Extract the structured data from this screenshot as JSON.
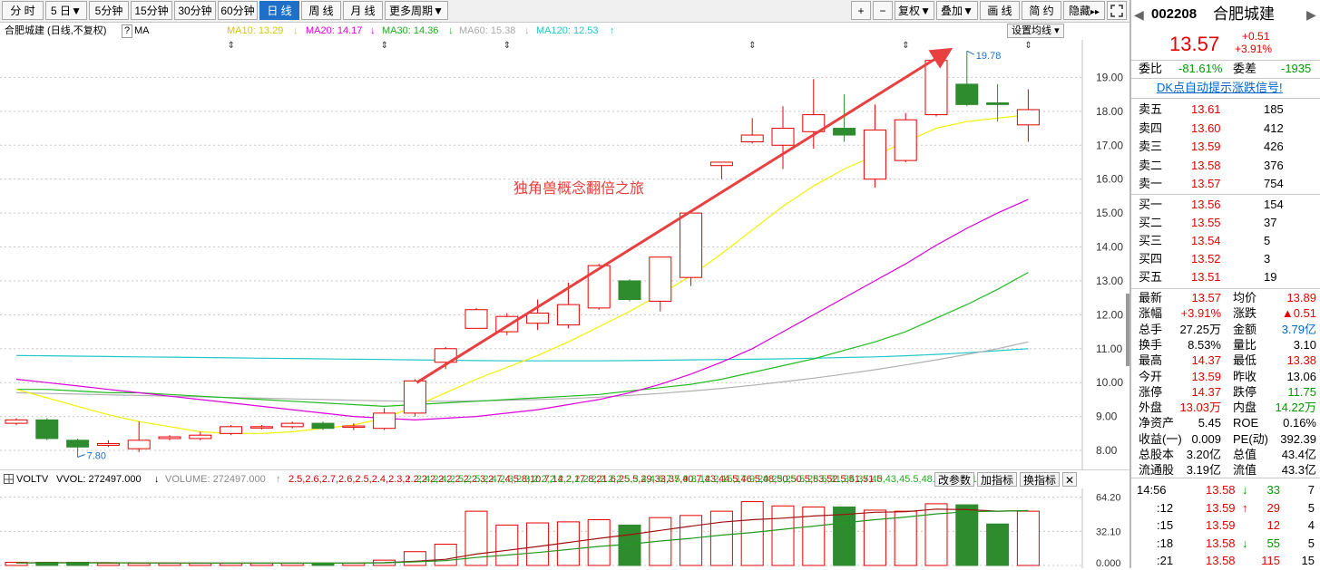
{
  "toolbar": {
    "periods": [
      "分 时",
      "5 日",
      "5分钟",
      "15分钟",
      "30分钟",
      "60分钟",
      "日 线",
      "周 线",
      "月 线",
      "更多周期"
    ],
    "active": "日 线",
    "right": [
      "+",
      "−",
      "复权",
      "叠加",
      "画 线",
      "简 约",
      "隐藏"
    ],
    "dropdown_arrow": "▼",
    "hide_arrows": "▸▸"
  },
  "info": {
    "stock_label": "合肥城建 (日线,不复权)",
    "help": "?",
    "ma": "MA",
    "ma10": "MA10: 13.29",
    "ma20": "MA20: 14.17",
    "ma30": "MA30: 14.36",
    "ma60": "MA60: 15.38",
    "ma120": "MA120: 12.53",
    "arrow_down": "↓",
    "arrow_up": "↑",
    "settings": "设置均线",
    "settings_arrow": "▾"
  },
  "colors": {
    "up": "#e60000",
    "down": "#2e8b2e",
    "ma10": "#f2f200",
    "ma20": "#dd00dd",
    "ma30": "#22bb22",
    "ma60": "#b0b0b0",
    "ma120": "#22c8c8",
    "accent": "#1e6fc8"
  },
  "chart_data": {
    "type": "candlestick",
    "annotation": "独角兽概念翻倍之旅",
    "max_label": "19.78",
    "min_label": "7.80",
    "y_ticks": [
      "19.00",
      "18.00",
      "17.00",
      "16.00",
      "15.00",
      "14.00",
      "13.00",
      "12.00",
      "11.00",
      "10.00",
      "9.00",
      "8.00"
    ],
    "ylim": [
      7.6,
      20.0
    ],
    "candles": [
      {
        "o": 8.8,
        "c": 8.9,
        "h": 8.95,
        "l": 8.75
      },
      {
        "o": 8.9,
        "c": 8.35,
        "h": 8.95,
        "l": 8.3
      },
      {
        "o": 8.3,
        "c": 8.1,
        "h": 8.35,
        "l": 7.8
      },
      {
        "o": 8.15,
        "c": 8.2,
        "h": 8.3,
        "l": 8.1
      },
      {
        "o": 8.05,
        "c": 8.3,
        "h": 8.85,
        "l": 7.95
      },
      {
        "o": 8.35,
        "c": 8.4,
        "h": 8.45,
        "l": 8.3
      },
      {
        "o": 8.35,
        "c": 8.45,
        "h": 8.55,
        "l": 8.3
      },
      {
        "o": 8.5,
        "c": 8.7,
        "h": 8.75,
        "l": 8.45
      },
      {
        "o": 8.68,
        "c": 8.7,
        "h": 8.75,
        "l": 8.62
      },
      {
        "o": 8.7,
        "c": 8.8,
        "h": 8.85,
        "l": 8.65
      },
      {
        "o": 8.8,
        "c": 8.65,
        "h": 8.85,
        "l": 8.6
      },
      {
        "o": 8.68,
        "c": 8.72,
        "h": 8.8,
        "l": 8.6
      },
      {
        "o": 8.65,
        "c": 9.1,
        "h": 9.25,
        "l": 8.6
      },
      {
        "o": 9.1,
        "c": 10.05,
        "h": 10.1,
        "l": 9.0
      },
      {
        "o": 10.6,
        "c": 11.0,
        "h": 11.05,
        "l": 10.4
      },
      {
        "o": 11.6,
        "c": 12.15,
        "h": 12.2,
        "l": 11.6
      },
      {
        "o": 11.5,
        "c": 11.95,
        "h": 12.05,
        "l": 11.4
      },
      {
        "o": 11.75,
        "c": 12.05,
        "h": 12.45,
        "l": 11.55
      },
      {
        "o": 11.7,
        "c": 12.3,
        "h": 12.95,
        "l": 11.6
      },
      {
        "o": 12.2,
        "c": 13.45,
        "h": 13.5,
        "l": 12.15
      },
      {
        "o": 13.0,
        "c": 12.45,
        "h": 13.05,
        "l": 12.4
      },
      {
        "o": 12.4,
        "c": 13.7,
        "h": 13.7,
        "l": 12.1
      },
      {
        "o": 13.1,
        "c": 15.0,
        "h": 15.0,
        "l": 12.85
      },
      {
        "o": 16.4,
        "c": 16.5,
        "h": 16.5,
        "l": 16.0
      },
      {
        "o": 17.1,
        "c": 17.3,
        "h": 17.8,
        "l": 17.05
      },
      {
        "o": 17.0,
        "c": 17.5,
        "h": 18.15,
        "l": 16.3
      },
      {
        "o": 17.4,
        "c": 17.9,
        "h": 18.95,
        "l": 16.9
      },
      {
        "o": 17.5,
        "c": 17.3,
        "h": 18.5,
        "l": 17.1
      },
      {
        "o": 16.0,
        "c": 17.45,
        "h": 18.2,
        "l": 15.75
      },
      {
        "o": 16.55,
        "c": 17.75,
        "h": 17.95,
        "l": 16.5
      },
      {
        "o": 17.9,
        "c": 19.5,
        "h": 19.55,
        "l": 17.85
      },
      {
        "o": 18.8,
        "c": 18.2,
        "h": 19.78,
        "l": 18.15
      },
      {
        "o": 18.25,
        "c": 18.2,
        "h": 18.8,
        "l": 17.7
      },
      {
        "o": 17.6,
        "c": 18.05,
        "h": 18.65,
        "l": 17.1
      }
    ],
    "ma10": [
      9.8,
      9.55,
      9.3,
      9.05,
      8.85,
      8.7,
      8.55,
      8.5,
      8.5,
      8.55,
      8.65,
      8.75,
      8.95,
      9.3,
      9.7,
      10.1,
      10.45,
      10.8,
      11.2,
      11.65,
      12.1,
      12.6,
      13.15,
      13.8,
      14.5,
      15.2,
      15.8,
      16.3,
      16.7,
      17.1,
      17.5,
      17.7,
      17.8,
      17.9
    ],
    "ma20": [
      10.1,
      10.0,
      9.9,
      9.8,
      9.7,
      9.6,
      9.5,
      9.4,
      9.3,
      9.2,
      9.1,
      9.0,
      8.95,
      8.9,
      8.95,
      9.0,
      9.1,
      9.2,
      9.35,
      9.5,
      9.7,
      9.95,
      10.25,
      10.6,
      11.0,
      11.5,
      12.0,
      12.5,
      13.0,
      13.5,
      14.05,
      14.55,
      15.0,
      15.4
    ],
    "ma30": [
      9.8,
      9.8,
      9.75,
      9.7,
      9.7,
      9.65,
      9.6,
      9.55,
      9.5,
      9.45,
      9.4,
      9.35,
      9.3,
      9.35,
      9.4,
      9.45,
      9.5,
      9.55,
      9.6,
      9.65,
      9.75,
      9.85,
      9.95,
      10.1,
      10.3,
      10.5,
      10.7,
      10.95,
      11.2,
      11.5,
      11.9,
      12.3,
      12.75,
      13.25
    ],
    "ma60": [
      9.7,
      9.68,
      9.66,
      9.64,
      9.62,
      9.6,
      9.58,
      9.56,
      9.54,
      9.52,
      9.5,
      9.48,
      9.46,
      9.45,
      9.45,
      9.46,
      9.48,
      9.5,
      9.53,
      9.57,
      9.62,
      9.68,
      9.75,
      9.83,
      9.92,
      10.02,
      10.13,
      10.25,
      10.38,
      10.52,
      10.67,
      10.83,
      11.0,
      11.2
    ],
    "ma120": [
      10.8,
      10.79,
      10.78,
      10.77,
      10.76,
      10.75,
      10.74,
      10.73,
      10.72,
      10.71,
      10.7,
      10.69,
      10.68,
      10.67,
      10.66,
      10.65,
      10.64,
      10.64,
      10.64,
      10.64,
      10.65,
      10.66,
      10.67,
      10.68,
      10.69,
      10.7,
      10.72,
      10.74,
      10.76,
      10.79,
      10.83,
      10.88,
      10.94,
      11.0
    ],
    "volume": {
      "label": "VOLTV",
      "vvol": "VVOL: 272497.000",
      "volume": "VOLUME: 272497.000",
      "mavol1": [
        2.5,
        2.6,
        2.7,
        2.6,
        2.5,
        2.4,
        2.3,
        2.2,
        2.2,
        2.2,
        2.2,
        2.3,
        2.7,
        4.0,
        5.8,
        10.7,
        14.2,
        17.8,
        21.6,
        25.5,
        29.0,
        33.0,
        37.0,
        40.7,
        43.0,
        44.5,
        46.5,
        48.0,
        50.0,
        50.5,
        53.0,
        52.5,
        51.0,
        51.5
      ],
      "mavol2": [
        2.4,
        2.4,
        2.5,
        2.5,
        2.4,
        2.3,
        2.3,
        2.2,
        2.2,
        2.2,
        2.2,
        2.2,
        2.5,
        3.4,
        4.6,
        7.5,
        9.8,
        12.2,
        15.0,
        17.9,
        20.0,
        23.0,
        25.5,
        28.5,
        31.0,
        34.0,
        37.0,
        40.0,
        43.0,
        45.5,
        48.5,
        50.5,
        51.0,
        51.5
      ],
      "buttons": [
        "改参数",
        "加指标",
        "换指标"
      ],
      "close": "✕",
      "y_ticks": [
        "64.20",
        "32.10",
        "0.000"
      ],
      "ylim": [
        0,
        69
      ],
      "values": [
        3,
        3,
        3,
        2,
        2,
        2,
        2,
        2,
        2,
        2,
        2,
        2,
        5,
        13,
        20,
        51,
        38,
        40,
        41,
        43,
        38,
        45,
        47,
        51,
        60,
        56,
        55,
        55,
        52,
        51,
        58,
        57,
        39,
        51
      ]
    }
  },
  "quote": {
    "code": "002208",
    "name": "合肥城建",
    "price": "13.57",
    "change": "+0.51",
    "pct": "+3.91%",
    "wb_label": "委比",
    "wb": "-81.61%",
    "wc_label": "委差",
    "wc": "-1935",
    "dk": "DK点自动提示涨跌信号!",
    "sell": [
      {
        "label": "卖五",
        "price": "13.61",
        "vol": "185"
      },
      {
        "label": "卖四",
        "price": "13.60",
        "vol": "412"
      },
      {
        "label": "卖三",
        "price": "13.59",
        "vol": "426"
      },
      {
        "label": "卖二",
        "price": "13.58",
        "vol": "376"
      },
      {
        "label": "卖一",
        "price": "13.57",
        "vol": "754"
      }
    ],
    "buy": [
      {
        "label": "买一",
        "price": "13.56",
        "vol": "154"
      },
      {
        "label": "买二",
        "price": "13.55",
        "vol": "37"
      },
      {
        "label": "买三",
        "price": "13.54",
        "vol": "5"
      },
      {
        "label": "买四",
        "price": "13.52",
        "vol": "3"
      },
      {
        "label": "买五",
        "price": "13.51",
        "vol": "19"
      }
    ],
    "stats": [
      {
        "l1": "最新",
        "v1": "13.57",
        "c1": "red",
        "l2": "均价",
        "v2": "13.89",
        "c2": "red"
      },
      {
        "l1": "涨幅",
        "v1": "+3.91%",
        "c1": "red",
        "l2": "涨跌",
        "v2": "▲0.51",
        "c2": "red"
      },
      {
        "l1": "总手",
        "v1": "27.25万",
        "c1": "black",
        "l2": "金额",
        "v2": "3.79亿",
        "c2": "blue"
      },
      {
        "l1": "换手",
        "v1": "8.53%",
        "c1": "black",
        "l2": "量比",
        "v2": "3.10",
        "c2": "black"
      },
      {
        "l1": "最高",
        "v1": "14.37",
        "c1": "red",
        "l2": "最低",
        "v2": "13.38",
        "c2": "red"
      },
      {
        "l1": "今开",
        "v1": "13.59",
        "c1": "red",
        "l2": "昨收",
        "v2": "13.06",
        "c2": "black"
      },
      {
        "l1": "涨停",
        "v1": "14.37",
        "c1": "red",
        "l2": "跌停",
        "v2": "11.75",
        "c2": "green"
      },
      {
        "l1": "外盘",
        "v1": "13.03万",
        "c1": "red",
        "l2": "内盘",
        "v2": "14.22万",
        "c2": "green"
      },
      {
        "l1": "净资产",
        "v1": "5.45",
        "c1": "black",
        "l2": "ROE",
        "v2": "0.16%",
        "c2": "black"
      },
      {
        "l1": "收益(一)",
        "v1": "0.009",
        "c1": "black",
        "l2": "PE(动)",
        "v2": "392.39",
        "c2": "black"
      },
      {
        "l1": "总股本",
        "v1": "3.20亿",
        "c1": "black",
        "l2": "总值",
        "v2": "43.4亿",
        "c2": "black"
      },
      {
        "l1": "流通股",
        "v1": "3.19亿",
        "c1": "black",
        "l2": "流值",
        "v2": "43.3亿",
        "c2": "black"
      }
    ],
    "ticks": [
      {
        "time": "14:56",
        "price": "13.58",
        "arrow": "↓",
        "vol": "33",
        "n": "7",
        "dir": "down"
      },
      {
        "time": ":12",
        "price": "13.59",
        "arrow": "↑",
        "vol": "29",
        "n": "5",
        "dir": "up"
      },
      {
        "time": ":15",
        "price": "13.59",
        "arrow": "",
        "vol": "12",
        "n": "4",
        "dir": "up"
      },
      {
        "time": ":18",
        "price": "13.58",
        "arrow": "↓",
        "vol": "55",
        "n": "5",
        "dir": "down"
      },
      {
        "time": ":21",
        "price": "13.58",
        "arrow": "",
        "vol": "115",
        "n": "15",
        "dir": "up"
      }
    ]
  }
}
